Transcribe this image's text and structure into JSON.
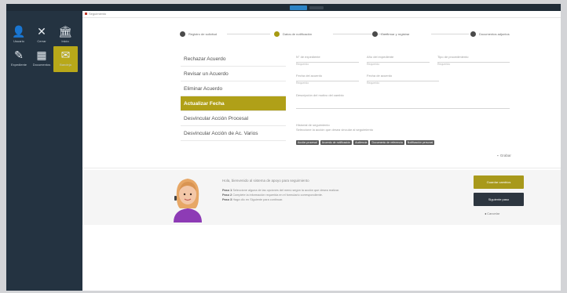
{
  "topbar": {
    "active_tab": "",
    "tab2": ""
  },
  "sidebar": {
    "items": [
      {
        "icon": "person-icon",
        "glyph": "👤",
        "label": "Usuario"
      },
      {
        "icon": "close-icon",
        "glyph": "✕",
        "label": "Cerrar"
      },
      {
        "icon": "building-icon",
        "glyph": "🏛",
        "label": "Inicio"
      },
      {
        "icon": "edit-icon",
        "glyph": "✎",
        "label": "Expediente"
      },
      {
        "icon": "document-icon",
        "glyph": "▦",
        "label": "Documentos"
      },
      {
        "icon": "inbox-icon",
        "glyph": "✉",
        "label": "Bandeja"
      }
    ]
  },
  "breadcrumb": {
    "label": "Seguimiento"
  },
  "stepper": {
    "steps": [
      {
        "label": "Registro de solicitud",
        "state": "done"
      },
      {
        "label": "Datos de notificación",
        "state": "active"
      },
      {
        "label": "Confirmar y registrar",
        "state": "pending"
      },
      {
        "label": "Documentos adjuntos",
        "state": "pending"
      }
    ]
  },
  "menu": {
    "items": [
      {
        "label": "Rechazar Acuerdo",
        "active": false
      },
      {
        "label": "Revisar un Acuerdo",
        "active": false
      },
      {
        "label": "Eliminar Acuerdo",
        "active": false
      },
      {
        "label": "Actualizar Fecha",
        "active": true
      },
      {
        "label": "Desvincular Acción Procesal",
        "active": false
      },
      {
        "label": "Desvincular Acción de Ac. Varios",
        "active": false
      }
    ]
  },
  "form": {
    "fields": [
      {
        "value": "N° de expediente",
        "hint": "Requerido"
      },
      {
        "value": "Año del expediente",
        "hint": "Requerido"
      },
      {
        "value": "Tipo de procedimiento",
        "hint": "Requerido"
      },
      {
        "value": "Fecha del acuerdo",
        "hint": "Requerido"
      },
      {
        "value": "Fecha de acuerdo",
        "hint": "Requerido"
      },
      {
        "value": "Descripción del motivo del cambio",
        "hint": ""
      }
    ],
    "info_lines": [
      "Historial de seguimiento",
      "Seleccione la acción que desea vincular al seguimiento"
    ],
    "tags": [
      "Acción procesal",
      "Acuerdo de notificación",
      "Audiencia",
      "Documento de referencia",
      "Notificación personal"
    ],
    "save_label": "Grabar"
  },
  "help": {
    "title": "Hola, bienvenido al sistema de apoyo para seguimiento",
    "steps": [
      {
        "key": "Paso 1",
        "text": "Seleccione alguna de las opciones del menú según la acción que desea realizar."
      },
      {
        "key": "Paso 2",
        "text": "Complete la información requerida en el formulario correspondiente."
      },
      {
        "key": "Paso 3",
        "text": "Haga clic en Siguiente para continuar."
      }
    ]
  },
  "buttons": {
    "primary": "Guardar cambios",
    "secondary": "Siguiente paso",
    "link": "Cancelar"
  },
  "colors": {
    "accent": "#b0a018",
    "sidebar": "#243341",
    "dark_button": "#2d3640"
  }
}
